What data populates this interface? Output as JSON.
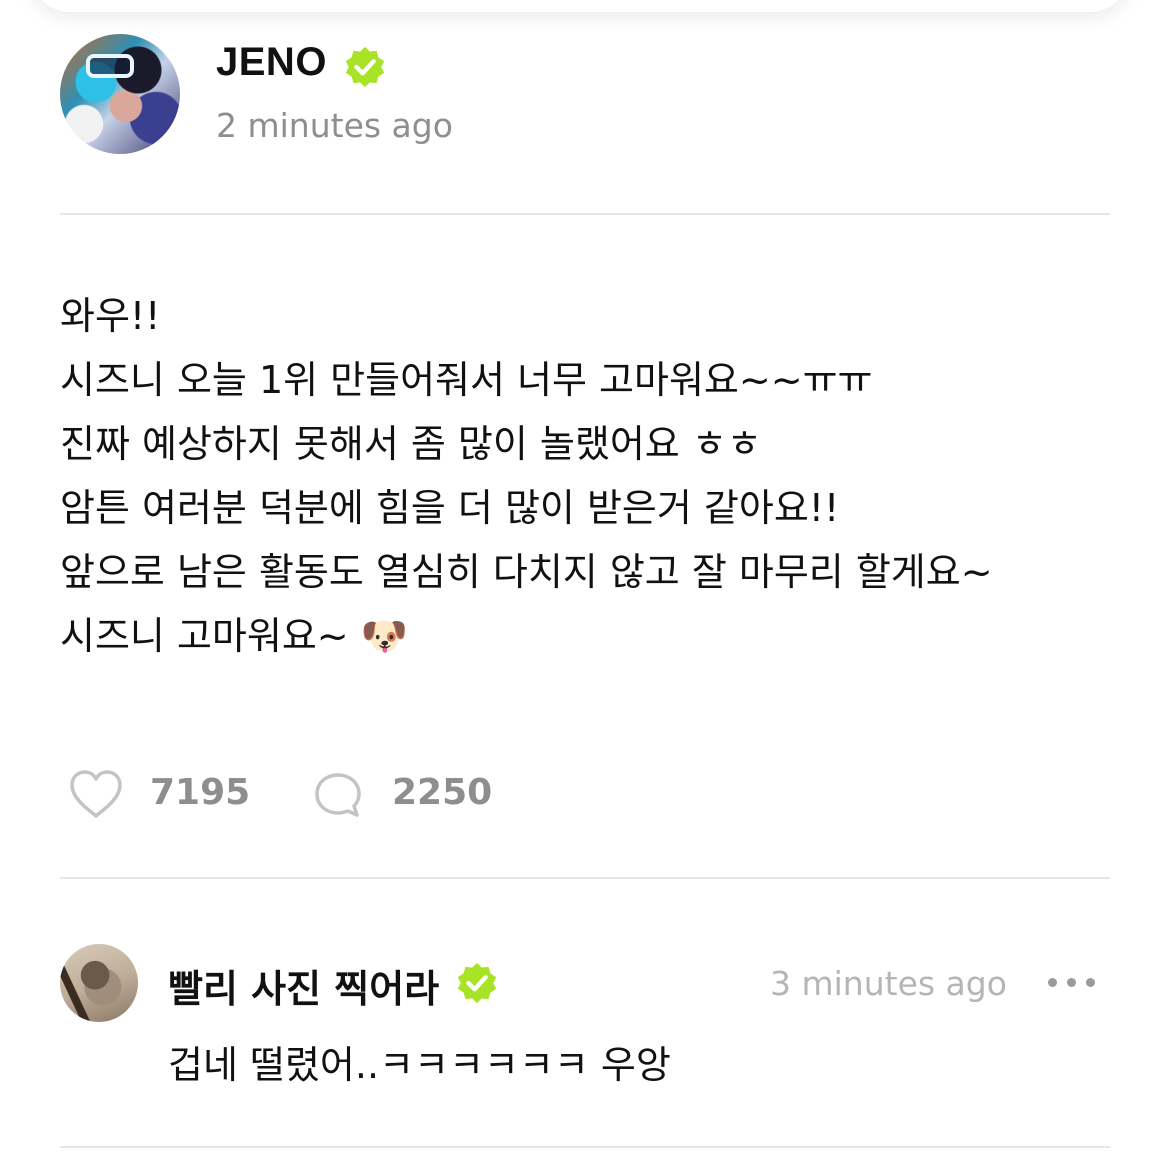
{
  "post": {
    "author": {
      "name": "JENO",
      "verified_icon": "verified-badge-icon",
      "avatar": "avatar-image"
    },
    "time": "2 minutes ago",
    "body_lines": [
      "와우!!",
      "시즈니 오늘 1위 만들어줘서 너무 고마워요~~ㅠㅠ",
      "진짜 예상하지 못해서 좀 많이 놀랬어요 ㅎㅎ",
      "암튼 여러분 덕분에 힘을 더 많이 받은거 같아요!!",
      "앞으로 남은 활동도 열심히 다치지 않고 잘 마무리 할게요~",
      "시즈니 고마워요~ 🐶"
    ],
    "likes": "7195",
    "comments": "2250"
  },
  "comment": {
    "author": "빨리 사진 찍어라",
    "verified_icon": "verified-badge-icon",
    "time": "3 minutes ago",
    "text": "겁네 떨렸어..ㅋㅋㅋㅋㅋㅋ 우앙"
  },
  "colors": {
    "verified": "#a9e327",
    "muted_text": "#8e8e8e",
    "divider": "#e6e6e6"
  }
}
